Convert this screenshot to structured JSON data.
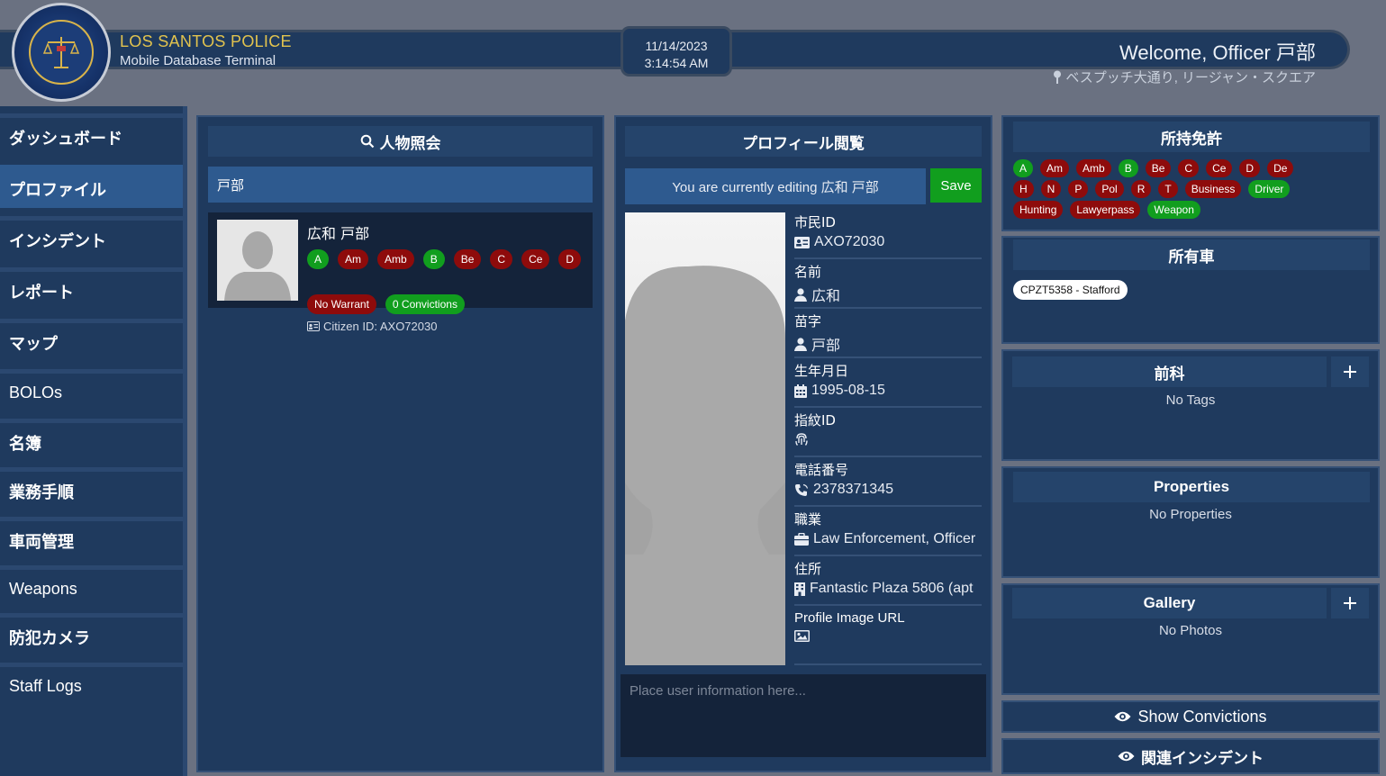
{
  "header": {
    "org_name": "LOS SANTOS POLICE",
    "subtitle": "Mobile Database Terminal",
    "date": "11/14/2023",
    "time": "3:14:54 AM",
    "welcome": "Welcome, Officer 戸部",
    "location": "ベスプッチ大通り, リージャン・スクエア",
    "logo_icon": "lspd-seal-icon",
    "location_icon": "map-pin-icon"
  },
  "sidebar": {
    "items": [
      {
        "label": "ダッシュボード",
        "active": false
      },
      {
        "label": "プロファイル",
        "active": true
      },
      {
        "label": "インシデント",
        "active": false
      },
      {
        "label": "レポート",
        "active": false
      },
      {
        "label": "マップ",
        "active": false
      },
      {
        "label": "BOLOs",
        "active": false
      },
      {
        "label": "名簿",
        "active": false
      },
      {
        "label": "業務手順",
        "active": false
      },
      {
        "label": "車両管理",
        "active": false
      },
      {
        "label": "Weapons",
        "active": false
      },
      {
        "label": "防犯カメラ",
        "active": false
      },
      {
        "label": "Staff Logs",
        "active": false
      }
    ]
  },
  "search": {
    "title": "人物照会",
    "icon": "search-icon",
    "query": "戸部",
    "result": {
      "name": "広和 戸部",
      "licenses": [
        {
          "label": "A",
          "status": "green"
        },
        {
          "label": "Am",
          "status": "red"
        },
        {
          "label": "Amb",
          "status": "red"
        },
        {
          "label": "B",
          "status": "green"
        },
        {
          "label": "Be",
          "status": "red"
        },
        {
          "label": "C",
          "status": "red"
        },
        {
          "label": "Ce",
          "status": "red"
        },
        {
          "label": "D",
          "status": "red"
        }
      ],
      "warrant": "No Warrant",
      "convictions": "0 Convictions",
      "citizen_id": "Citizen ID: AXO72030"
    }
  },
  "profile": {
    "title": "プロフィール閲覧",
    "editing_text": "You are currently editing 広和 戸部",
    "save_label": "Save",
    "fields": [
      {
        "label": "市民ID",
        "value": "AXO72030",
        "icon": "id-card-icon"
      },
      {
        "label": "名前",
        "value": "広和",
        "icon": "user-icon"
      },
      {
        "label": "苗字",
        "value": "戸部",
        "icon": "user-icon"
      },
      {
        "label": "生年月日",
        "value": "1995-08-15",
        "icon": "calendar-icon"
      },
      {
        "label": "指紋ID",
        "value": "",
        "icon": "fingerprint-icon"
      },
      {
        "label": "電話番号",
        "value": "2378371345",
        "icon": "phone-icon"
      },
      {
        "label": "職業",
        "value": "Law Enforcement, Officer",
        "icon": "briefcase-icon"
      },
      {
        "label": "住所",
        "value": "Fantastic Plaza 5806 (apt",
        "icon": "building-icon"
      },
      {
        "label": "Profile Image URL",
        "value": "",
        "icon": "image-icon"
      }
    ],
    "notes_placeholder": "Place user information here..."
  },
  "licenses": {
    "title": "所持免許",
    "items": [
      {
        "label": "A",
        "status": "green"
      },
      {
        "label": "Am",
        "status": "red"
      },
      {
        "label": "Amb",
        "status": "red"
      },
      {
        "label": "B",
        "status": "green"
      },
      {
        "label": "Be",
        "status": "red"
      },
      {
        "label": "C",
        "status": "red"
      },
      {
        "label": "Ce",
        "status": "red"
      },
      {
        "label": "D",
        "status": "red"
      },
      {
        "label": "De",
        "status": "red"
      },
      {
        "label": "H",
        "status": "red"
      },
      {
        "label": "N",
        "status": "red"
      },
      {
        "label": "P",
        "status": "red"
      },
      {
        "label": "Pol",
        "status": "red"
      },
      {
        "label": "R",
        "status": "red"
      },
      {
        "label": "T",
        "status": "red"
      },
      {
        "label": "Business",
        "status": "red"
      },
      {
        "label": "Driver",
        "status": "green"
      },
      {
        "label": "Hunting",
        "status": "red"
      },
      {
        "label": "Lawyerpass",
        "status": "red"
      },
      {
        "label": "Weapon",
        "status": "green"
      }
    ]
  },
  "vehicles": {
    "title": "所有車",
    "items": [
      "CPZT5358 - Stafford"
    ]
  },
  "records": {
    "title": "前科",
    "empty": "No Tags"
  },
  "properties": {
    "title": "Properties",
    "empty": "No Properties"
  },
  "gallery": {
    "title": "Gallery",
    "empty": "No Photos"
  },
  "actions": {
    "show_convictions": "Show Convictions",
    "related_incidents": "関連インシデント"
  },
  "colors": {
    "panel": "#1f3a5e",
    "panel_head": "#25446b",
    "accent": "#2e5a8f",
    "license_valid": "#119e1e",
    "license_invalid": "#8e0b0b",
    "brand_gold": "#e2c34e"
  }
}
